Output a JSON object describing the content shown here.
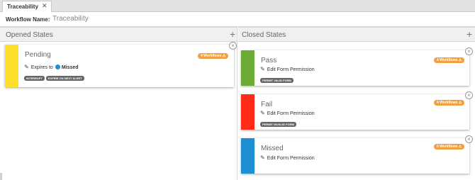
{
  "tab": {
    "label": "Traceability",
    "close": "✕"
  },
  "workflow": {
    "label": "Workflow Name:",
    "value": "Traceability"
  },
  "opened": {
    "title": "Opened States",
    "add": "+",
    "cards": [
      {
        "title": "Pending",
        "color": "#ffe02b",
        "expires_text": "Expires to",
        "expires_state": "Missed",
        "expires_dot_color": "#1f8fd3",
        "badge": "4 Workflows",
        "tags": [
          "INTERRUPT",
          "EXPIRE ON NEXT ALERT"
        ]
      }
    ]
  },
  "closed": {
    "title": "Closed States",
    "add": "+",
    "cards": [
      {
        "title": "Pass",
        "color": "#6cac36",
        "detail": "Edit Form Permission",
        "badge": "4 Workflows",
        "tags": [
          "PERMIT VALID FORM"
        ]
      },
      {
        "title": "Fail",
        "color": "#ff2a18",
        "detail": "Edit Form Permission",
        "badge": "4 Workflows",
        "tags": [
          "PERMIT INVALID FORM"
        ]
      },
      {
        "title": "Missed",
        "color": "#1f8fd3",
        "detail": "Edit Form Permission",
        "badge": "0 Workflows",
        "tags": []
      }
    ]
  },
  "icons": {
    "pencil": "pencil-icon",
    "close": "close-circle-icon",
    "warning": "warning-icon"
  },
  "colors": {
    "badge": "#f0a040",
    "tag": "#666666"
  }
}
